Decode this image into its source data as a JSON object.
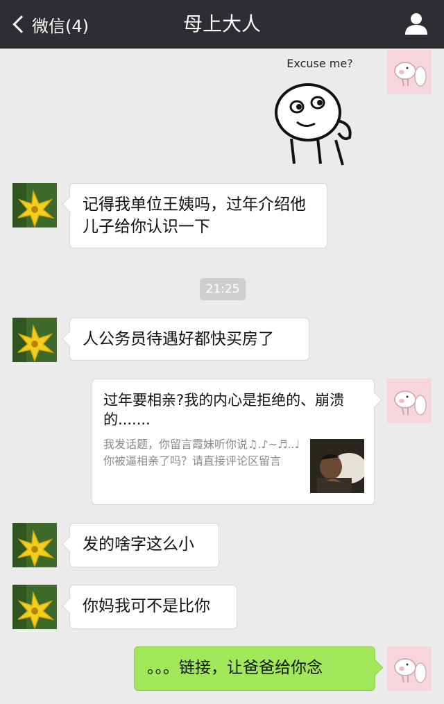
{
  "header": {
    "back_label": "微信(4)",
    "title": "母上大人"
  },
  "messages": {
    "sticker_caption": "Excuse me?",
    "m1": "记得我单位王姨吗，过年介绍他儿子给你认识一下",
    "time": "21:25",
    "m2": "人公务员待遇好都快买房了",
    "card_title": "过年要相亲?我的内心是拒绝的、崩溃的.......",
    "card_desc": "我发话题，你留言霞妹听你说♫.♪~♬..♩你被逼相亲了吗？请直接评论区留言",
    "m3": "发的啥字这么小",
    "m4": "你妈我可不是比你",
    "m5": "。。。链接，让爸爸给你念"
  },
  "colors": {
    "header_bg": "#2e2e32",
    "chat_bg": "#ebebeb",
    "sent_bubble": "#a0e75a",
    "received_bubble": "#ffffff"
  }
}
